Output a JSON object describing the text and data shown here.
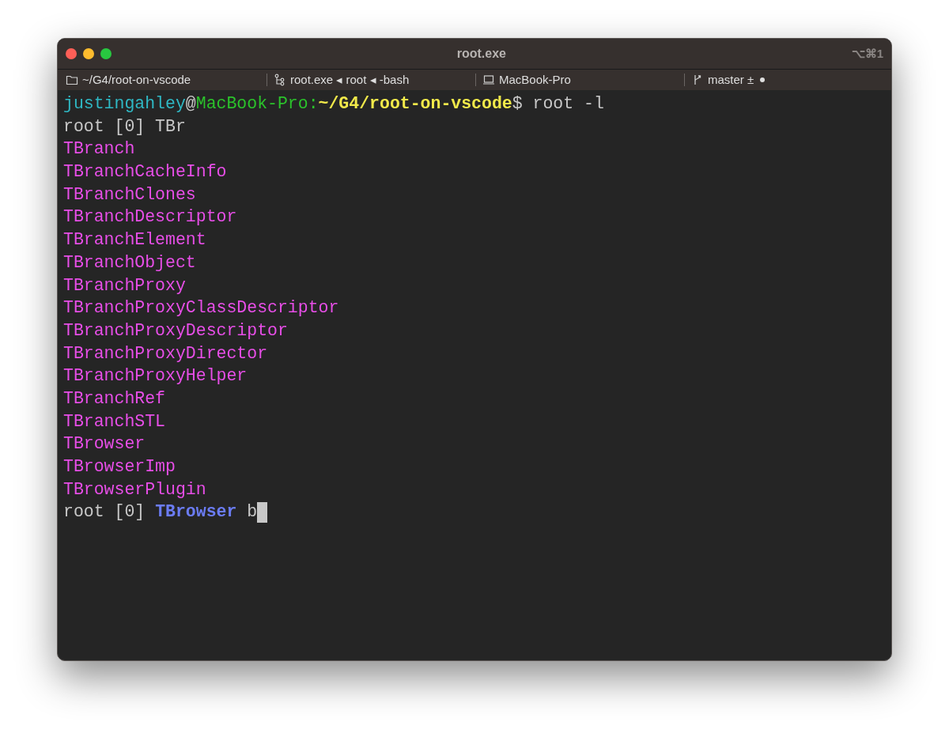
{
  "window": {
    "title": "root.exe",
    "shortcut": "⌥⌘1"
  },
  "tabs": [
    {
      "kind": "folder",
      "label": "~/G4/root-on-vscode"
    },
    {
      "kind": "process",
      "label": "root.exe ◂ root ◂ -bash"
    },
    {
      "kind": "host",
      "label": "MacBook-Pro"
    },
    {
      "kind": "branch",
      "label": "master ±"
    }
  ],
  "terminal": {
    "lines": [
      [
        {
          "kind": "user",
          "text": "justingahley"
        },
        {
          "kind": "plain",
          "text": "@"
        },
        {
          "kind": "host",
          "text": "MacBook-Pro:"
        },
        {
          "kind": "path",
          "text": "~/G4/root-on-vscode"
        },
        {
          "kind": "plain",
          "text": "$ root -l"
        }
      ],
      [
        {
          "kind": "plain",
          "text": "root [0] TBr"
        }
      ],
      [
        {
          "kind": "match",
          "text": "TBranch"
        }
      ],
      [
        {
          "kind": "match",
          "text": "TBranchCacheInfo"
        }
      ],
      [
        {
          "kind": "match",
          "text": "TBranchClones"
        }
      ],
      [
        {
          "kind": "match",
          "text": "TBranchDescriptor"
        }
      ],
      [
        {
          "kind": "match",
          "text": "TBranchElement"
        }
      ],
      [
        {
          "kind": "match",
          "text": "TBranchObject"
        }
      ],
      [
        {
          "kind": "match",
          "text": "TBranchProxy"
        }
      ],
      [
        {
          "kind": "match",
          "text": "TBranchProxyClassDescriptor"
        }
      ],
      [
        {
          "kind": "match",
          "text": "TBranchProxyDescriptor"
        }
      ],
      [
        {
          "kind": "match",
          "text": "TBranchProxyDirector"
        }
      ],
      [
        {
          "kind": "match",
          "text": "TBranchProxyHelper"
        }
      ],
      [
        {
          "kind": "match",
          "text": "TBranchRef"
        }
      ],
      [
        {
          "kind": "match",
          "text": "TBranchSTL"
        }
      ],
      [
        {
          "kind": "match",
          "text": "TBrowser"
        }
      ],
      [
        {
          "kind": "match",
          "text": "TBrowserImp"
        }
      ],
      [
        {
          "kind": "match",
          "text": "TBrowserPlugin"
        }
      ],
      [
        {
          "kind": "plain",
          "text": "root [0] "
        },
        {
          "kind": "class",
          "text": "TBrowser"
        },
        {
          "kind": "plain",
          "text": " b"
        },
        {
          "kind": "cursor"
        }
      ]
    ]
  }
}
